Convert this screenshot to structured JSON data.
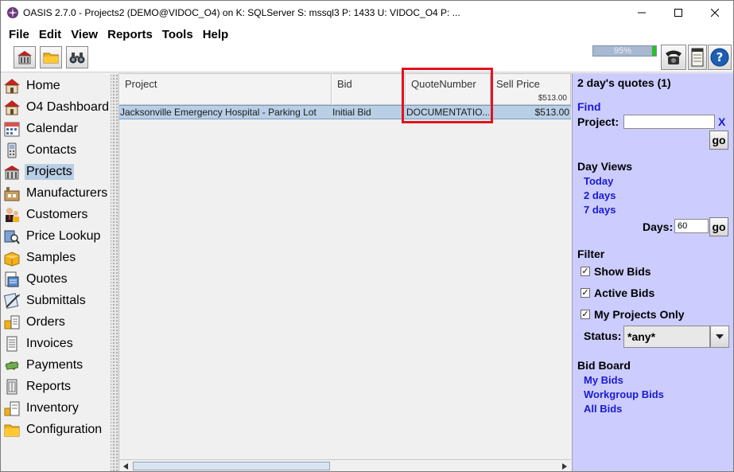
{
  "window": {
    "title": "OASIS 2.7.0 - Projects2 (DEMO@VIDOC_O4) on K: SQLServer  S: mssql3  P: 1433  U: VIDOC_O4  P: ..."
  },
  "menu": [
    "File",
    "Edit",
    "View",
    "Reports",
    "Tools",
    "Help"
  ],
  "toolbar": {
    "progress_text": "95%",
    "progress_value": 0.95
  },
  "sidebar": {
    "items": [
      {
        "label": "Home",
        "icon": "house-icon"
      },
      {
        "label": "O4 Dashboard",
        "icon": "house-icon"
      },
      {
        "label": "Calendar",
        "icon": "calendar-icon"
      },
      {
        "label": "Contacts",
        "icon": "phone-icon"
      },
      {
        "label": "Projects",
        "icon": "building-icon"
      },
      {
        "label": "Manufacturers",
        "icon": "factory-icon"
      },
      {
        "label": "Customers",
        "icon": "people-icon"
      },
      {
        "label": "Price Lookup",
        "icon": "magnifier-icon"
      },
      {
        "label": "Samples",
        "icon": "box-icon"
      },
      {
        "label": "Quotes",
        "icon": "quote-icon"
      },
      {
        "label": "Submittals",
        "icon": "submittal-icon"
      },
      {
        "label": "Orders",
        "icon": "orders-icon"
      },
      {
        "label": "Invoices",
        "icon": "invoice-icon"
      },
      {
        "label": "Payments",
        "icon": "payment-icon"
      },
      {
        "label": "Reports",
        "icon": "report-icon"
      },
      {
        "label": "Inventory",
        "icon": "inventory-icon"
      },
      {
        "label": "Configuration",
        "icon": "folder-icon"
      }
    ],
    "active": "Projects"
  },
  "table": {
    "columns": [
      "Project",
      "Bid",
      "QuoteNumber",
      "Sell Price"
    ],
    "sell_price_total": "$513.00",
    "rows": [
      {
        "project": "Jacksonville Emergency Hospital - Parking Lot",
        "bid": "Initial Bid",
        "quote_number": "DOCUMENTATIO...",
        "sell_price": "$513.00"
      }
    ]
  },
  "panel": {
    "title": "2 day's quotes (1)",
    "find_label": "Find",
    "project_label": "Project:",
    "project_value": "",
    "clear_label": "X",
    "go_label": "go",
    "day_views_label": "Day Views",
    "day_views": [
      "Today",
      "2 days",
      "7 days"
    ],
    "days_label": "Days:",
    "days_value": "60",
    "filter_label": "Filter",
    "filters": [
      {
        "label": "Show Bids",
        "checked": true
      },
      {
        "label": "Active Bids",
        "checked": true
      },
      {
        "label": "My Projects Only",
        "checked": true
      }
    ],
    "status_label": "Status:",
    "status_value": "*any*",
    "bid_board_label": "Bid Board",
    "bid_board_links": [
      "My Bids",
      "Workgroup Bids",
      "All Bids"
    ]
  }
}
